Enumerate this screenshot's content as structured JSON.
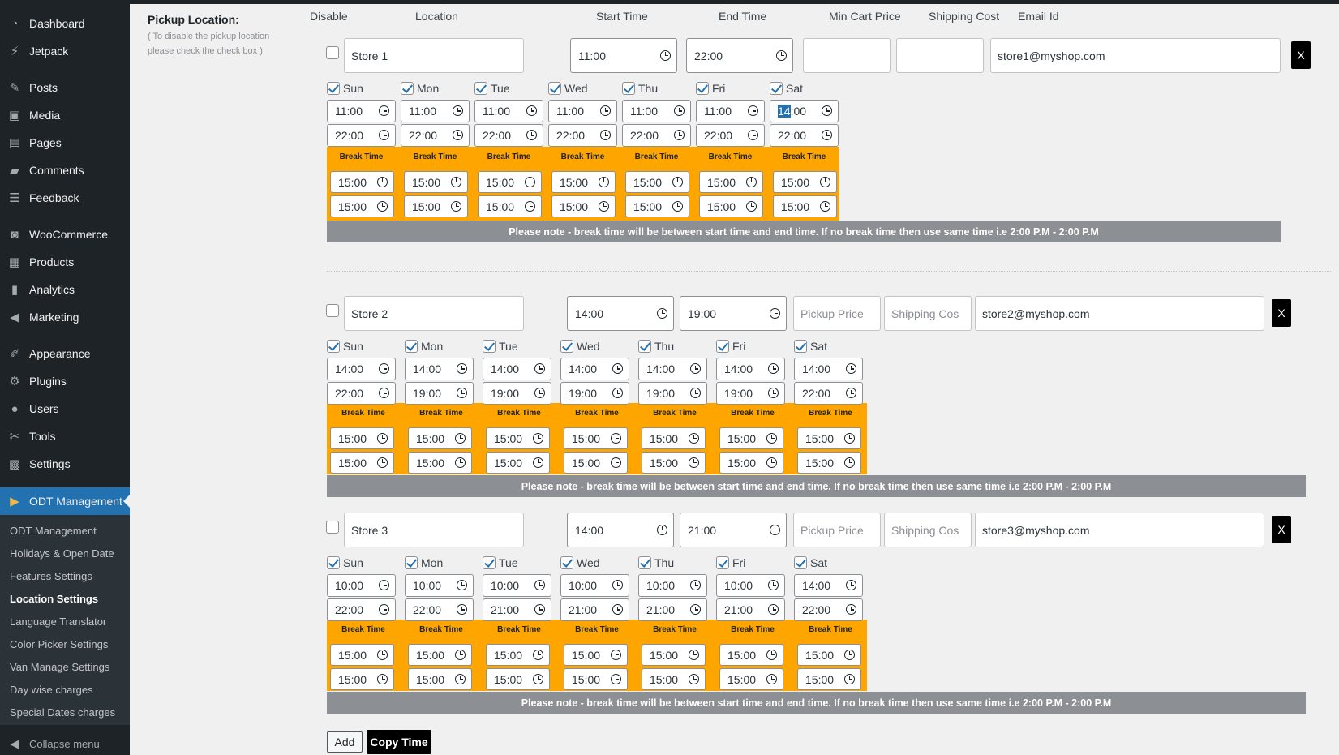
{
  "sidebar": {
    "items": [
      {
        "label": "Dashboard",
        "icon": "gauge-icon"
      },
      {
        "label": "Jetpack",
        "icon": "jetpack-icon"
      },
      {
        "label": "Posts",
        "icon": "pin-icon"
      },
      {
        "label": "Media",
        "icon": "media-icon"
      },
      {
        "label": "Pages",
        "icon": "page-icon"
      },
      {
        "label": "Comments",
        "icon": "comment-icon"
      },
      {
        "label": "Feedback",
        "icon": "feedback-icon"
      },
      {
        "label": "WooCommerce",
        "icon": "woo-icon"
      },
      {
        "label": "Products",
        "icon": "archive-icon"
      },
      {
        "label": "Analytics",
        "icon": "chart-icon"
      },
      {
        "label": "Marketing",
        "icon": "megaphone-icon"
      },
      {
        "label": "Appearance",
        "icon": "brush-icon"
      },
      {
        "label": "Plugins",
        "icon": "plug-icon"
      },
      {
        "label": "Users",
        "icon": "user-icon"
      },
      {
        "label": "Tools",
        "icon": "wrench-icon"
      },
      {
        "label": "Settings",
        "icon": "settings-icon"
      },
      {
        "label": "ODT Management",
        "icon": "truck-icon"
      }
    ],
    "submenu": [
      "ODT Management",
      "Holidays & Open Date",
      "Features Settings",
      "Location Settings",
      "Language Translator",
      "Color Picker Settings",
      "Van Manage Settings",
      "Day wise charges",
      "Special Dates charges"
    ],
    "collapse": "Collapse menu"
  },
  "form": {
    "label": "Pickup Location:",
    "hint": "( To disable the pickup location please check the check box )",
    "headers": [
      "Disable",
      "Location",
      "Start Time",
      "End Time",
      "Min Cart Price",
      "Shipping Cost",
      "Email Id"
    ],
    "break_label": "Break Time",
    "note": "Please note - break time will be between start time and end time. If no break time then use same time i.e 2:00 P.M - 2:00 P.M",
    "remove_label": "X",
    "days": [
      "Sun",
      "Mon",
      "Tue",
      "Wed",
      "Thu",
      "Fri",
      "Sat"
    ],
    "pickup_price_placeholder": "Pickup Price",
    "shipping_cost_placeholder": "Shipping Cos",
    "add_label": "Add",
    "copy_label": "Copy Time"
  },
  "stores": [
    {
      "name": "Store 1",
      "start": "11:00",
      "end": "22:00",
      "min_cart": "",
      "shipping": "",
      "email": "store1@myshop.com",
      "day_start": [
        "11:00",
        "11:00",
        "11:00",
        "11:00",
        "11:00",
        "11:00",
        "14:00"
      ],
      "day_end": [
        "22:00",
        "22:00",
        "22:00",
        "22:00",
        "22:00",
        "22:00",
        "22:00"
      ],
      "break_start": [
        "15:00",
        "15:00",
        "15:00",
        "15:00",
        "15:00",
        "15:00",
        "15:00"
      ],
      "break_end": [
        "15:00",
        "15:00",
        "15:00",
        "15:00",
        "15:00",
        "15:00",
        "15:00"
      ]
    },
    {
      "name": "Store 2",
      "start": "14:00",
      "end": "19:00",
      "email": "store2@myshop.com",
      "day_start": [
        "14:00",
        "14:00",
        "14:00",
        "14:00",
        "14:00",
        "14:00",
        "14:00"
      ],
      "day_end": [
        "22:00",
        "19:00",
        "19:00",
        "19:00",
        "19:00",
        "19:00",
        "22:00"
      ],
      "break_start": [
        "15:00",
        "15:00",
        "15:00",
        "15:00",
        "15:00",
        "15:00",
        "15:00"
      ],
      "break_end": [
        "15:00",
        "15:00",
        "15:00",
        "15:00",
        "15:00",
        "15:00",
        "15:00"
      ]
    },
    {
      "name": "Store 3",
      "start": "14:00",
      "end": "21:00",
      "email": "store3@myshop.com",
      "day_start": [
        "10:00",
        "10:00",
        "10:00",
        "10:00",
        "10:00",
        "10:00",
        "14:00"
      ],
      "day_end": [
        "22:00",
        "22:00",
        "21:00",
        "21:00",
        "21:00",
        "21:00",
        "22:00"
      ],
      "break_start": [
        "15:00",
        "15:00",
        "15:00",
        "15:00",
        "15:00",
        "15:00",
        "15:00"
      ],
      "break_end": [
        "15:00",
        "15:00",
        "15:00",
        "15:00",
        "15:00",
        "15:00",
        "15:00"
      ]
    }
  ]
}
